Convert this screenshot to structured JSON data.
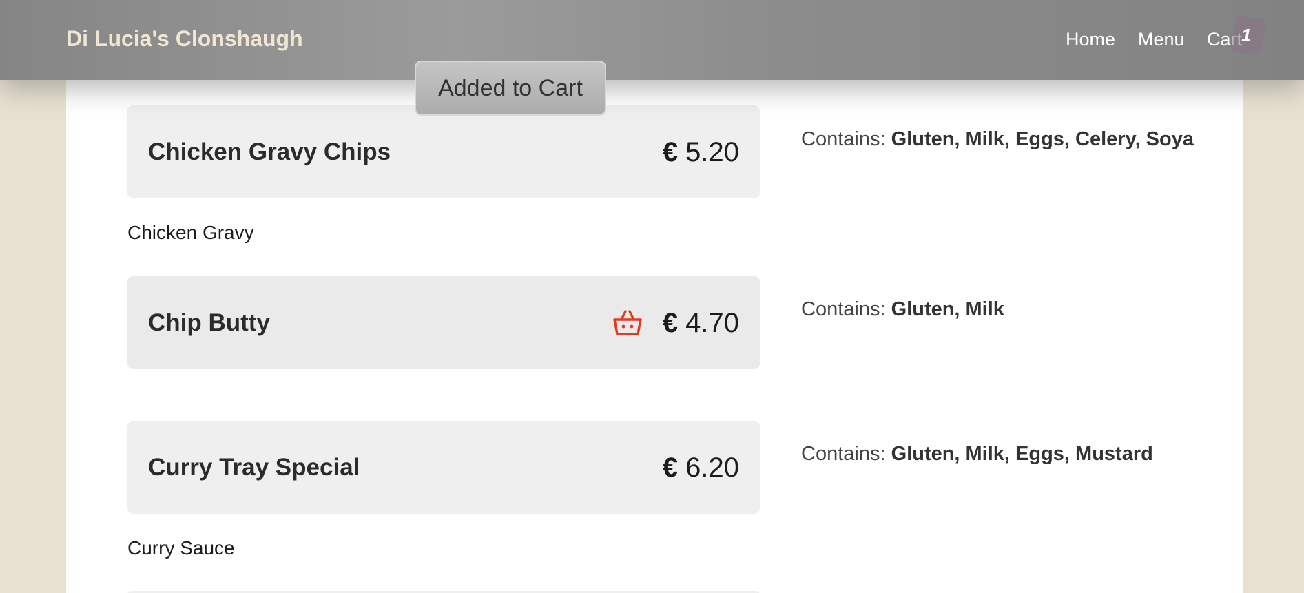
{
  "navbar": {
    "brand": "Di Lucia's Clonshaugh",
    "links": [
      "Home",
      "Menu",
      "Cart"
    ],
    "cart_count": "1"
  },
  "toast": "Added to Cart",
  "items": [
    {
      "name": "Chicken Gravy Chips",
      "currency": "€",
      "price": "5.20",
      "description": "Chicken Gravy",
      "allergens_label": "Contains:",
      "allergens": "Gluten, Milk, Eggs, Celery, Soya"
    },
    {
      "name": "Chip Butty",
      "currency": "€",
      "price": "4.70",
      "description": "",
      "allergens_label": "Contains:",
      "allergens": "Gluten, Milk",
      "icon": "basket-icon"
    },
    {
      "name": "Curry Tray Special",
      "currency": "€",
      "price": "6.20",
      "description": "Curry Sauce",
      "allergens_label": "Contains:",
      "allergens": "Gluten, Milk, Eggs, Mustard"
    }
  ],
  "colors": {
    "navbar": "#8f8f8f",
    "brand": "#f0e6d2",
    "background": "#e8e1d1",
    "card": "#efefef",
    "basket_icon": "#e8381e"
  }
}
